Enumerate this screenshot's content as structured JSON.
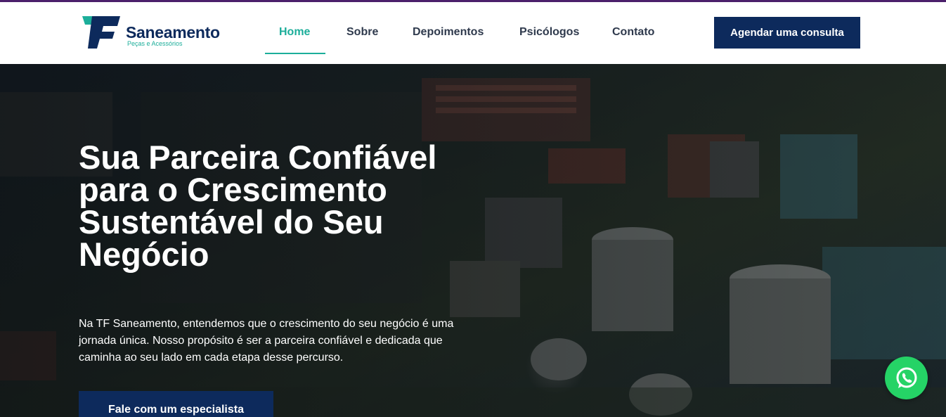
{
  "brand": {
    "name": "Saneamento",
    "tagline": "Peças e Acessórios",
    "logo_icon": "tf-logo-mark"
  },
  "nav": {
    "items": [
      {
        "label": "Home",
        "active": true
      },
      {
        "label": "Sobre",
        "active": false
      },
      {
        "label": "Depoimentos",
        "active": false
      },
      {
        "label": "Psicólogos",
        "active": false
      },
      {
        "label": "Contato",
        "active": false
      }
    ],
    "cta_label": "Agendar uma consulta"
  },
  "hero": {
    "title": "Sua Parceira Confiável para o Crescimento Sustentável do Seu Negócio",
    "text": "Na TF Saneamento, entendemos que o crescimento do seu negócio é uma jornada única. Nosso propósito é ser a parceira confiável e dedicada que caminha ao seu lado em cada etapa desse percurso.",
    "cta_label": "Fale com um especialista",
    "background_icon": "industrial-plant-photo"
  },
  "floating": {
    "whatsapp_icon": "whatsapp-icon"
  },
  "colors": {
    "primary": "#0d2a5c",
    "accent": "#1cae9a",
    "top_strip": "#4b1f6b",
    "whatsapp": "#25d366"
  }
}
